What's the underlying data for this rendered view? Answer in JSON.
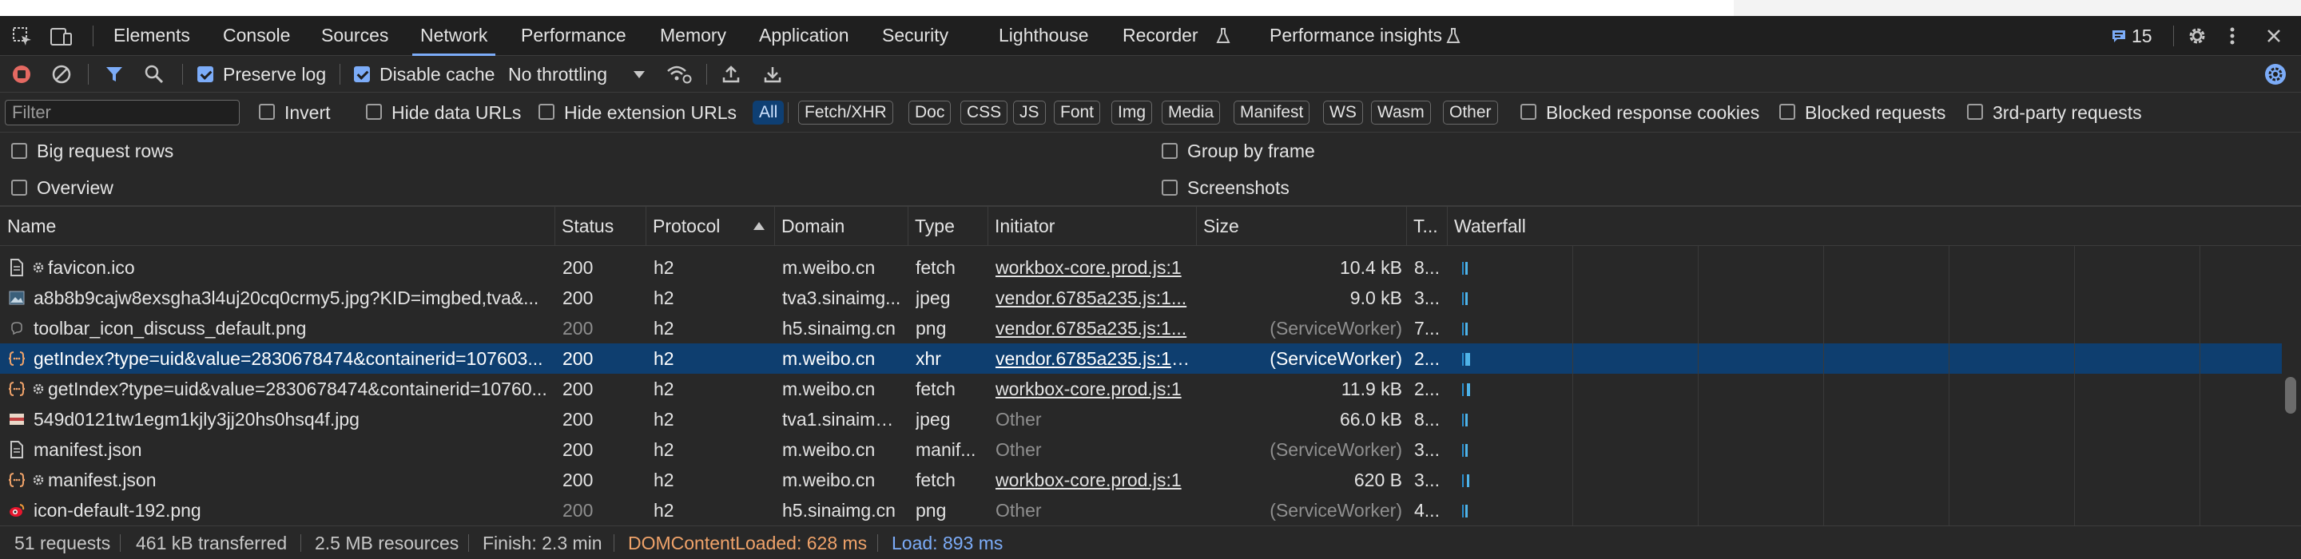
{
  "tabs": [
    {
      "label": "Elements"
    },
    {
      "label": "Console"
    },
    {
      "label": "Sources"
    },
    {
      "label": "Network",
      "active": true
    },
    {
      "label": "Performance"
    },
    {
      "label": "Memory"
    },
    {
      "label": "Application"
    },
    {
      "label": "Security"
    },
    {
      "label": "Lighthouse"
    },
    {
      "label": "Recorder"
    },
    {
      "label": "Performance insights"
    }
  ],
  "issues_count": "15",
  "controls": {
    "preserve_log": "Preserve log",
    "disable_cache": "Disable cache",
    "throttling": "No throttling"
  },
  "filter": {
    "placeholder": "Filter",
    "invert": "Invert",
    "hide_data_urls": "Hide data URLs",
    "hide_extension_urls": "Hide extension URLs",
    "types": [
      "All",
      "Fetch/XHR",
      "Doc",
      "CSS",
      "JS",
      "Font",
      "Img",
      "Media",
      "Manifest",
      "WS",
      "Wasm",
      "Other"
    ],
    "blocked_response_cookies": "Blocked response cookies",
    "blocked_requests": "Blocked requests",
    "third_party": "3rd-party requests"
  },
  "options": {
    "big_request_rows": "Big request rows",
    "group_by_frame": "Group by frame",
    "overview": "Overview",
    "screenshots": "Screenshots"
  },
  "columns": {
    "name": "Name",
    "status": "Status",
    "protocol": "Protocol",
    "domain": "Domain",
    "type": "Type",
    "initiator": "Initiator",
    "size": "Size",
    "time": "T...",
    "waterfall": "Waterfall"
  },
  "requests": [
    {
      "name": "favicon.ico",
      "gear": true,
      "icon": "doc",
      "status": "200",
      "protocol": "h2",
      "domain": "m.weibo.cn",
      "type": "fetch",
      "initiator": "workbox-core.prod.js:1",
      "initiator_link": true,
      "size": "10.4 kB",
      "size_dim": false,
      "time": "8...",
      "dim": false
    },
    {
      "name": "a8b8b9cajw8exsgha3l4uj20cq0crmy5.jpg?KID=imgbed,tva&...",
      "gear": false,
      "icon": "img",
      "status": "200",
      "protocol": "h2",
      "domain": "tva3.sinaimg...",
      "type": "jpeg",
      "initiator": "vendor.6785a235.js:1...",
      "initiator_link": true,
      "size": "9.0 kB",
      "size_dim": false,
      "time": "3...",
      "dim": false
    },
    {
      "name": "toolbar_icon_discuss_default.png",
      "gear": false,
      "icon": "png",
      "status": "200",
      "protocol": "h2",
      "domain": "h5.sinaimg.cn",
      "type": "png",
      "initiator": "vendor.6785a235.js:1...",
      "initiator_link": true,
      "size": "(ServiceWorker)",
      "size_dim": true,
      "time": "7...",
      "dim": true
    },
    {
      "name": "getIndex?type=uid&value=2830678474&containerid=107603...",
      "gear": false,
      "icon": "xhr",
      "status": "200",
      "protocol": "h2",
      "domain": "m.weibo.cn",
      "type": "xhr",
      "initiator": "vendor.6785a235.js:151",
      "initiator_link": true,
      "size": "(ServiceWorker)",
      "size_dim": false,
      "time": "2...",
      "dim": false,
      "selected": true
    },
    {
      "name": "getIndex?type=uid&value=2830678474&containerid=10760...",
      "gear": true,
      "icon": "xhr",
      "status": "200",
      "protocol": "h2",
      "domain": "m.weibo.cn",
      "type": "fetch",
      "initiator": "workbox-core.prod.js:1",
      "initiator_link": true,
      "size": "11.9 kB",
      "size_dim": false,
      "time": "2...",
      "dim": false
    },
    {
      "name": "549d0121tw1egm1kjly3jj20hs0hsq4f.jpg",
      "gear": false,
      "icon": "flag",
      "status": "200",
      "protocol": "h2",
      "domain": "tva1.sinaimg....",
      "type": "jpeg",
      "initiator": "Other",
      "initiator_link": false,
      "size": "66.0 kB",
      "size_dim": false,
      "time": "8...",
      "dim": false
    },
    {
      "name": "manifest.json",
      "gear": false,
      "icon": "doc",
      "status": "200",
      "protocol": "h2",
      "domain": "m.weibo.cn",
      "type": "manif...",
      "initiator": "Other",
      "initiator_link": false,
      "size": "(ServiceWorker)",
      "size_dim": true,
      "time": "3...",
      "dim": false
    },
    {
      "name": "manifest.json",
      "gear": true,
      "icon": "xhr",
      "status": "200",
      "protocol": "h2",
      "domain": "m.weibo.cn",
      "type": "fetch",
      "initiator": "workbox-core.prod.js:1",
      "initiator_link": true,
      "size": "620 B",
      "size_dim": false,
      "time": "3...",
      "dim": false
    },
    {
      "name": "icon-default-192.png",
      "gear": false,
      "icon": "weibo",
      "status": "200",
      "protocol": "h2",
      "domain": "h5.sinaimg.cn",
      "type": "png",
      "initiator": "Other",
      "initiator_link": false,
      "size": "(ServiceWorker)",
      "size_dim": true,
      "time": "4...",
      "dim": true
    }
  ],
  "status": {
    "requests": "51 requests",
    "transferred": "461 kB transferred",
    "resources": "2.5 MB resources",
    "finish": "Finish: 2.3 min",
    "dom_content_loaded": "DOMContentLoaded: 628 ms",
    "load": "Load: 893 ms"
  },
  "colors": {
    "accent": "#7cacf8",
    "dcl": "#f0a36a",
    "load": "#7cacf8",
    "selected_row": "#0e3e6f",
    "record": "#e46962"
  }
}
